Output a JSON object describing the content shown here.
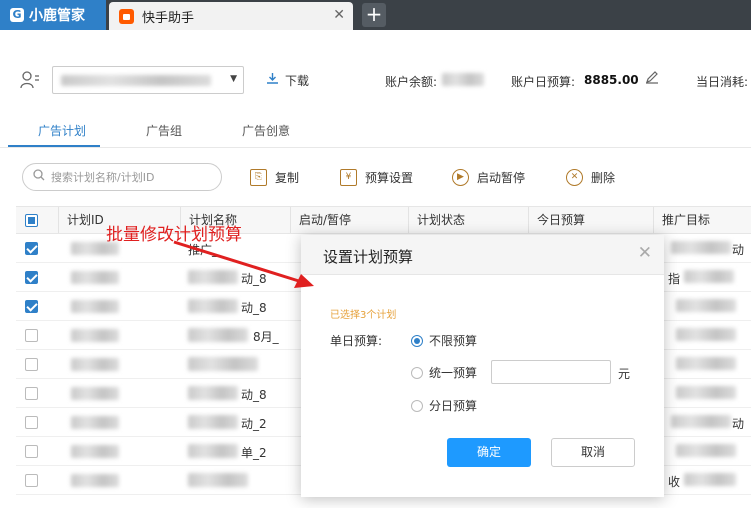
{
  "browser": {
    "brand": "小鹿管家",
    "tab_title": "快手助手",
    "close_glyph": "✕",
    "new_tab_glyph": "+"
  },
  "account": {
    "download_label": "下载",
    "balance_label": "账户余额:",
    "daily_budget_label": "账户日预算:",
    "daily_budget_value": "8885.00",
    "today_spend_label": "当日消耗:"
  },
  "tabs": [
    {
      "label": "广告计划",
      "active": true
    },
    {
      "label": "广告组",
      "active": false
    },
    {
      "label": "广告创意",
      "active": false
    }
  ],
  "toolbar": {
    "search_placeholder": "搜索计划名称/计划ID",
    "copy_label": "复制",
    "budget_label": "预算设置",
    "toggle_label": "启动暂停",
    "delete_label": "删除"
  },
  "table": {
    "columns": [
      "计划ID",
      "计划名称",
      "启动/暂停",
      "计划状态",
      "今日预算",
      "推广目标"
    ],
    "rows": [
      {
        "checked": true,
        "name_fragment": "推广_",
        "target_fragment": "动"
      },
      {
        "checked": true,
        "name_fragment": "动_8",
        "target_fragment": "指"
      },
      {
        "checked": true,
        "name_fragment": "动_8",
        "target_fragment": ""
      },
      {
        "checked": false,
        "name_fragment": "8月_",
        "target_fragment": ""
      },
      {
        "checked": false,
        "name_fragment": "",
        "target_fragment": ""
      },
      {
        "checked": false,
        "name_fragment": "动_8",
        "target_fragment": ""
      },
      {
        "checked": false,
        "name_fragment": "动_2",
        "target_fragment": "动"
      },
      {
        "checked": false,
        "name_fragment": "单_2",
        "target_fragment": ""
      },
      {
        "checked": false,
        "name_fragment": "",
        "target_fragment": "收"
      }
    ]
  },
  "annotation": {
    "text": "批量修改计划预算",
    "color": "#e02020"
  },
  "modal": {
    "title": "设置计划预算",
    "selected_note": "已选择3个计划",
    "budget_label": "单日预算:",
    "options": [
      {
        "label": "不限预算",
        "selected": true
      },
      {
        "label": "统一预算",
        "selected": false
      },
      {
        "label": "分日预算",
        "selected": false
      }
    ],
    "amount_value": "",
    "unit": "元",
    "confirm_label": "确定",
    "cancel_label": "取消"
  },
  "colors": {
    "accent": "#2f80c8",
    "confirm_button": "#1e9aff",
    "note": "#e6a23c"
  }
}
